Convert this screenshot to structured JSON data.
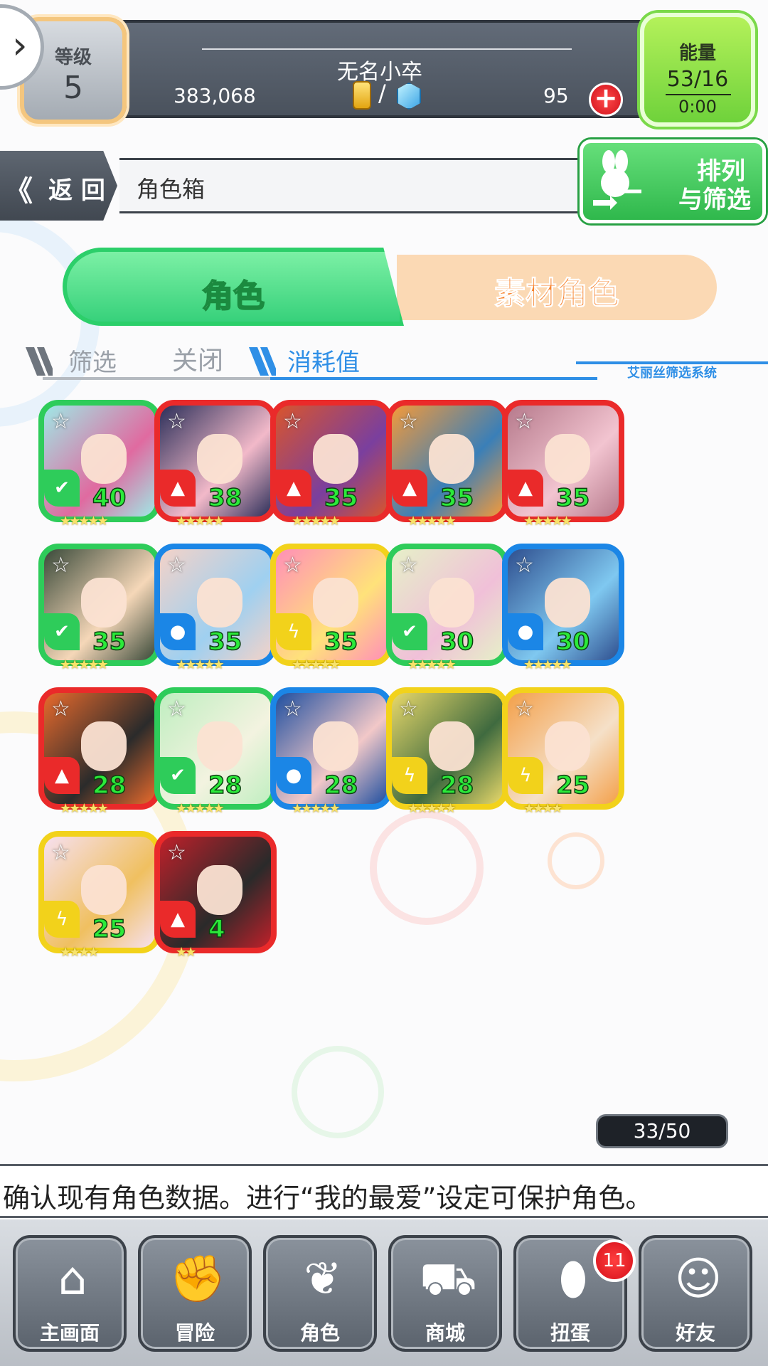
{
  "header": {
    "level_label": "等级",
    "level_value": "5",
    "username": "无名小卒",
    "coins": "383,068",
    "gems": "95",
    "currency_separator": "/",
    "energy_label": "能量",
    "energy_value": "53/16",
    "energy_timer": "0:00"
  },
  "nav": {
    "back_arrow": "《",
    "back_label": "返 回",
    "page_title": "角色箱",
    "sort_line1": "排列",
    "sort_line2": "与筛选"
  },
  "tabs": {
    "characters": "角色",
    "materials": "素材角色"
  },
  "filter": {
    "filter_label": "筛选",
    "filter_state": "关闭",
    "sort_by": "消耗值",
    "system_name": "艾丽丝筛选系统"
  },
  "characters": [
    {
      "level": "40",
      "element": "wind",
      "stars": "★★★★★"
    },
    {
      "level": "38",
      "element": "fire",
      "stars": "★★★★★"
    },
    {
      "level": "35",
      "element": "fire",
      "stars": "★★★★★"
    },
    {
      "level": "35",
      "element": "fire",
      "stars": "★★★★★"
    },
    {
      "level": "35",
      "element": "fire",
      "stars": "★★★★★"
    },
    {
      "level": "35",
      "element": "wind",
      "stars": "★★★★★"
    },
    {
      "level": "35",
      "element": "water",
      "stars": "★★★★★"
    },
    {
      "level": "35",
      "element": "thunder",
      "stars": "★★★★★"
    },
    {
      "level": "30",
      "element": "wind",
      "stars": "★★★★★"
    },
    {
      "level": "30",
      "element": "water",
      "stars": "★★★★★"
    },
    {
      "level": "28",
      "element": "fire",
      "stars": "★★★★★"
    },
    {
      "level": "28",
      "element": "wind",
      "stars": "★★★★★"
    },
    {
      "level": "28",
      "element": "water",
      "stars": "★★★★★"
    },
    {
      "level": "28",
      "element": "thunder",
      "stars": "★★★★★"
    },
    {
      "level": "25",
      "element": "thunder",
      "stars": "★★★★"
    },
    {
      "level": "25",
      "element": "thunder",
      "stars": "★★★★"
    },
    {
      "level": "4",
      "element": "fire",
      "stars": "★★"
    }
  ],
  "capacity": "33/50",
  "hint": "确认现有角色数据。进行“我的最爱”设定可保护角色。",
  "bottom_nav": [
    {
      "label": "主画面",
      "icon": "home-icon"
    },
    {
      "label": "冒险",
      "icon": "handshake-icon"
    },
    {
      "label": "角色",
      "icon": "bunny-icon"
    },
    {
      "label": "商城",
      "icon": "cart-icon"
    },
    {
      "label": "扭蛋",
      "icon": "egg-icon"
    },
    {
      "label": "好友",
      "icon": "friends-icon"
    }
  ],
  "gacha_badge": "11",
  "colors": {
    "wind": "#2ecc5a",
    "fire": "#ea2a2a",
    "water": "#1b86e6",
    "thunder": "#f2d21b",
    "accent_green": "#37d17b",
    "accent_orange": "#f7822c",
    "accent_blue": "#2f8fe6"
  }
}
